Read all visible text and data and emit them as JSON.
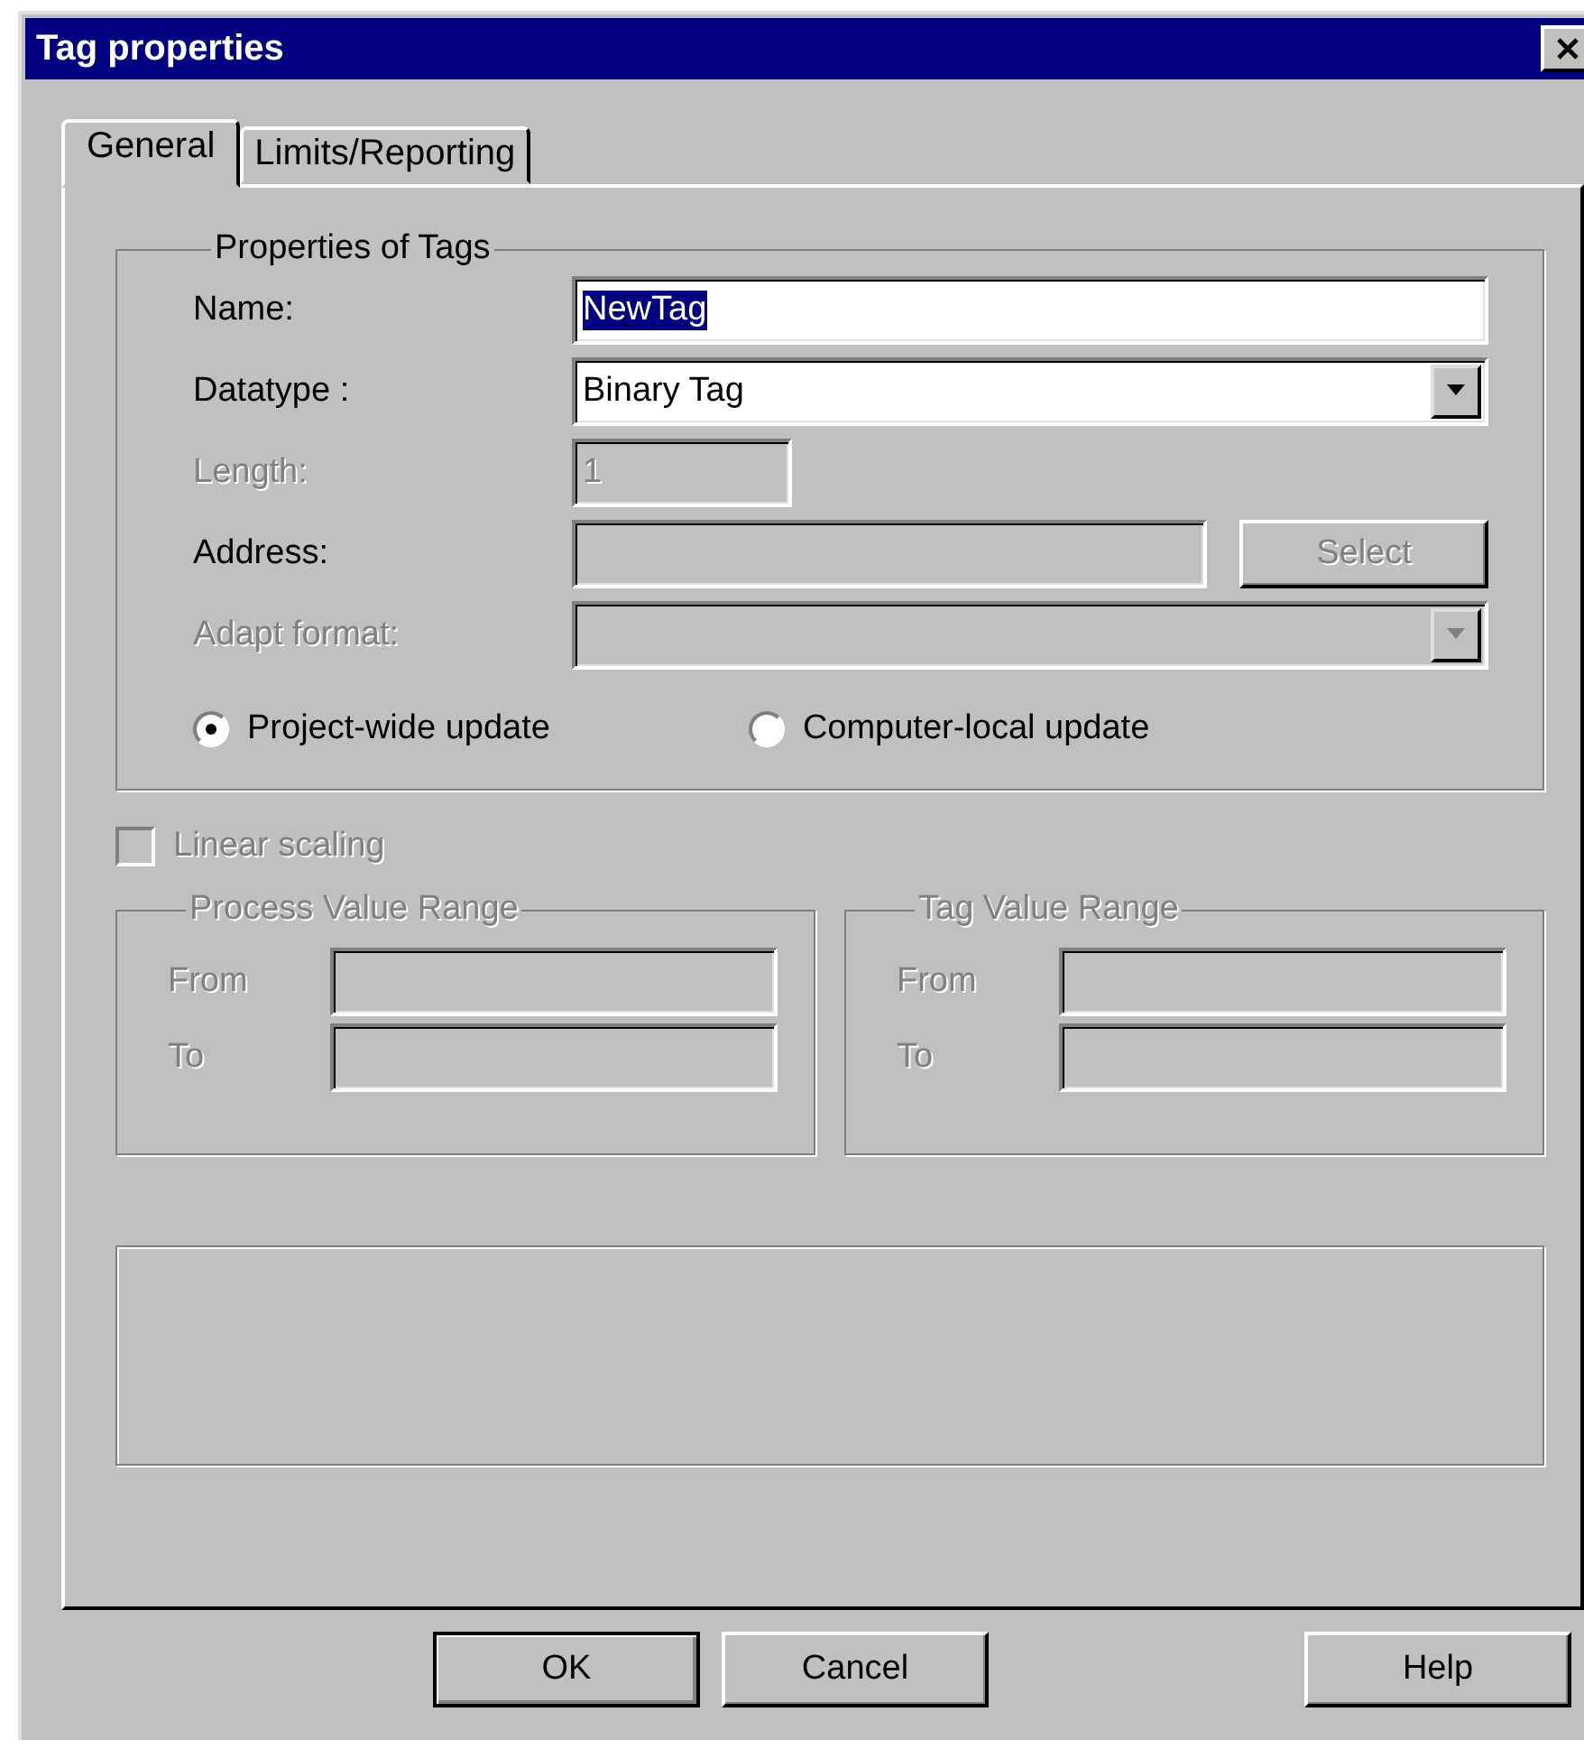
{
  "window": {
    "title": "Tag properties"
  },
  "tabs": [
    {
      "label": "General",
      "selected": true
    },
    {
      "label": "Limits/Reporting",
      "selected": false
    }
  ],
  "properties_group": {
    "title": "Properties of Tags",
    "fields": [
      {
        "kind": "text",
        "label": "Name:",
        "value": "NewTag",
        "text_selected": true,
        "disabled": false,
        "editable": true
      },
      {
        "kind": "combo",
        "label": "Datatype :",
        "value": "Binary Tag",
        "disabled": false,
        "editable": true
      },
      {
        "kind": "short",
        "label": "Length:",
        "value": "1",
        "disabled": true,
        "editable": false
      },
      {
        "kind": "button",
        "label": "Address:",
        "button": "Select",
        "button_disabled": true,
        "disabled": false,
        "editable": false
      },
      {
        "kind": "combo",
        "label": "Adapt format:",
        "disabled": true,
        "editable": false
      }
    ],
    "radios": [
      {
        "label": "Project-wide update",
        "selected": true
      },
      {
        "label": "Computer-local update",
        "selected": false
      }
    ]
  },
  "linear_scaling": {
    "label": "Linear scaling",
    "checked": false,
    "disabled": true
  },
  "ranges": [
    {
      "title": "Process Value Range",
      "disabled": true,
      "rows": [
        "From",
        "To"
      ]
    },
    {
      "title": "Tag Value Range",
      "disabled": true,
      "rows": [
        "From",
        "To"
      ]
    }
  ],
  "buttons": [
    {
      "label": "OK",
      "default": true
    },
    {
      "label": "Cancel",
      "default": false
    },
    {
      "label": "Help",
      "default": false
    }
  ]
}
